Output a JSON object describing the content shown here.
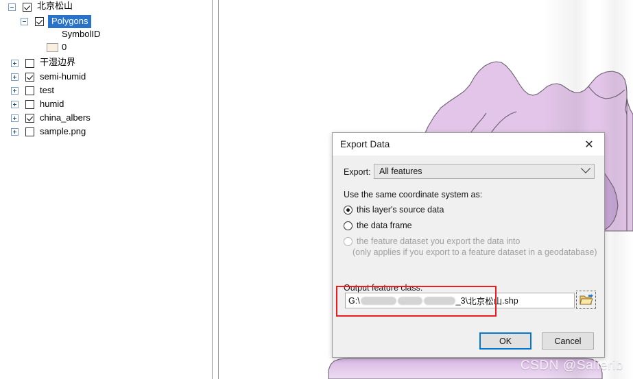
{
  "toc": {
    "items": [
      {
        "label": "北京松山",
        "checked": true,
        "expander": "minus",
        "indent": 0,
        "selected": false,
        "cjk": true
      },
      {
        "label": "Polygons",
        "checked": true,
        "expander": "minus",
        "indent": 1,
        "selected": true,
        "cjk": false
      },
      {
        "label": "干湿边界",
        "checked": false,
        "expander": "plus",
        "indent": 0,
        "selected": false,
        "cjk": true
      },
      {
        "label": "semi-humid",
        "checked": true,
        "expander": "plus",
        "indent": 0,
        "selected": false,
        "cjk": false
      },
      {
        "label": "test",
        "checked": false,
        "expander": "plus",
        "indent": 0,
        "selected": false,
        "cjk": false
      },
      {
        "label": "humid",
        "checked": false,
        "expander": "plus",
        "indent": 0,
        "selected": false,
        "cjk": false
      },
      {
        "label": "china_albers",
        "checked": true,
        "expander": "plus",
        "indent": 0,
        "selected": false,
        "cjk": false
      },
      {
        "label": "sample.png",
        "checked": false,
        "expander": "plus",
        "indent": 0,
        "selected": false,
        "cjk": false
      }
    ],
    "symbol_field": "SymbolID",
    "symbol_value": "0",
    "symbol_color": "#faf0e1"
  },
  "dialog": {
    "title": "Export Data",
    "close_icon": "close-icon",
    "export_label": "Export:",
    "export_value": "All features",
    "coordinate_prompt": "Use the same coordinate system as:",
    "radios": [
      {
        "label": "this layer's source data",
        "selected": true,
        "disabled": false
      },
      {
        "label": "the data frame",
        "selected": false,
        "disabled": false
      },
      {
        "label": "the feature dataset you export the data into",
        "selected": false,
        "disabled": true
      }
    ],
    "radio_note": "(only applies if you export to a feature dataset in a geodatabase)",
    "output_label": "Output feature class:",
    "path_prefix": "G:\\",
    "path_suffix_segment": "_3\\",
    "path_filename_cjk": "北京松山",
    "path_extension": ".shp",
    "browse_icon": "folder-browse-icon",
    "ok_label": "OK",
    "cancel_label": "Cancel",
    "highlight_color": "#ee1c1c",
    "accent_color": "#0078d7"
  },
  "map": {
    "polygon_fill": "#e2c5e8",
    "polygon_stroke": "#6b6070"
  },
  "watermark": "CSDN @Salierib"
}
